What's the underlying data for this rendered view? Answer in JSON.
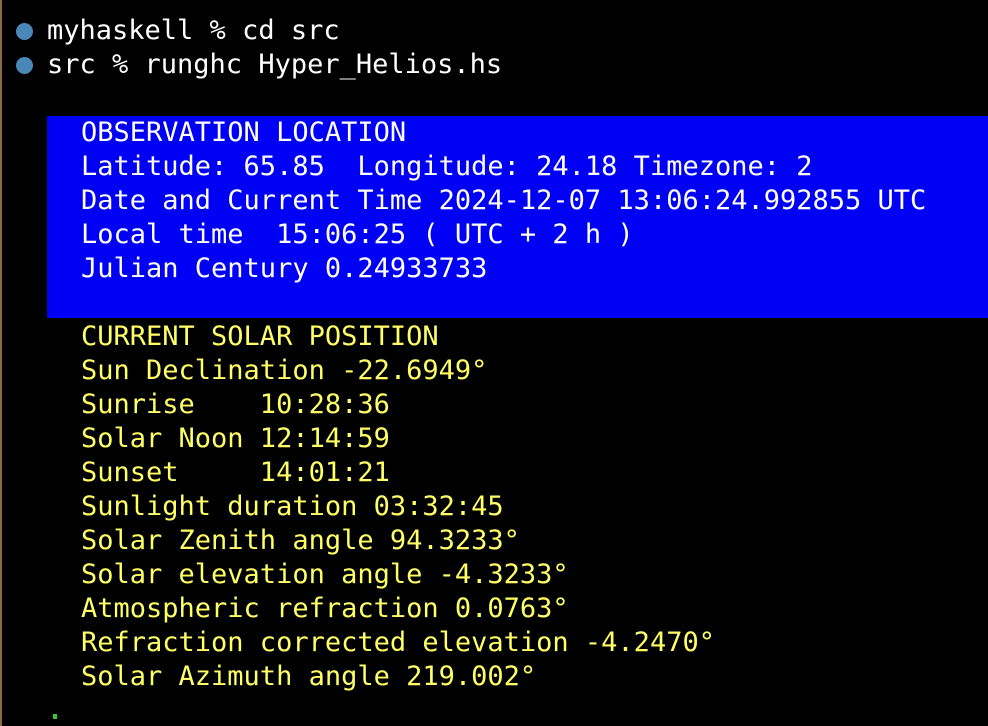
{
  "terminal": {
    "colors": {
      "background": "#000000",
      "prompt_dot": "#4a86b8",
      "info_panel_bg": "#0000f4",
      "info_text": "#ffffff",
      "solar_text": "#ffff66",
      "cursor": "#33cc33"
    },
    "history": [
      {
        "text": "myhaskell % cd src"
      },
      {
        "text": "src % runghc Hyper_Helios.hs"
      }
    ],
    "observation": {
      "lines": [
        "OBSERVATION LOCATION",
        "Latitude: 65.85  Longitude: 24.18 Timezone: 2",
        "Date and Current Time 2024-12-07 13:06:24.992855 UTC",
        "Local time  15:06:25 ( UTC + 2 h )",
        "Julian Century 0.24933733"
      ]
    },
    "solar": {
      "lines": [
        "CURRENT SOLAR POSITION",
        "Sun Declination -22.6949°",
        "Sunrise    10:28:36",
        "Solar Noon 12:14:59",
        "Sunset     14:01:21",
        "Sunlight duration 03:32:45",
        "Solar Zenith angle 94.3233°",
        "Solar elevation angle -4.3233°",
        "Atmospheric refraction 0.0763°",
        "Refraction corrected elevation -4.2470°",
        "Solar Azimuth angle 219.002°"
      ]
    }
  }
}
